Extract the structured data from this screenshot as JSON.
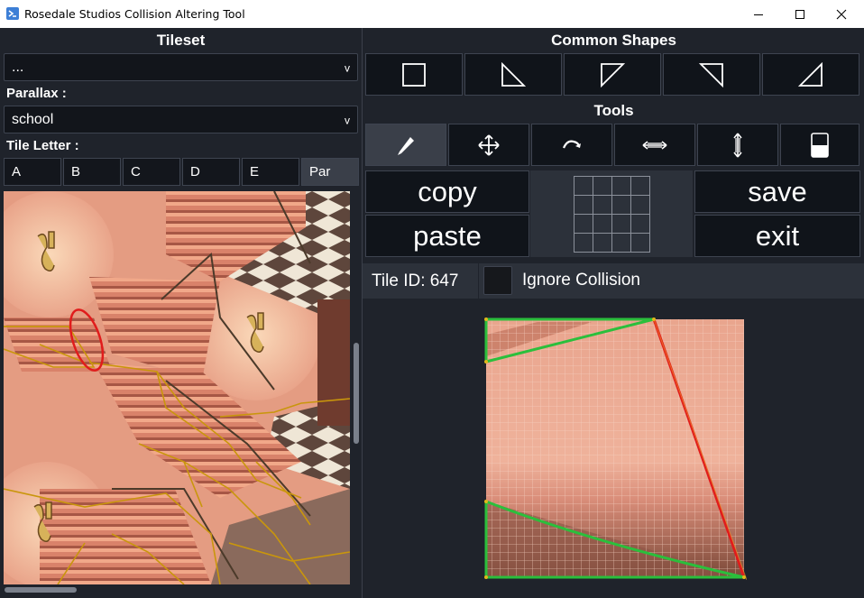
{
  "window": {
    "title": "Rosedale Studios Collision Altering Tool",
    "controls": [
      "minimize-icon",
      "maximize-icon",
      "close-icon"
    ]
  },
  "left_panel": {
    "tileset_header": "Tileset",
    "tileset_value": "...",
    "parallax_label": "Parallax :",
    "parallax_value": "school",
    "tile_letter_label": "Tile Letter :",
    "letters": [
      "A",
      "B",
      "C",
      "D",
      "E",
      "Par"
    ],
    "active_letter": "Par",
    "dropdown_arrow": "v"
  },
  "right_panel": {
    "common_shapes_header": "Common Shapes",
    "shapes": [
      "square-shape-icon",
      "triangle-bottom-left-icon",
      "triangle-top-left-icon",
      "triangle-top-right-icon",
      "triangle-bottom-right-icon"
    ],
    "tools_header": "Tools",
    "tools": [
      "pencil-icon",
      "move-icon",
      "rotate-icon",
      "flip-horizontal-icon",
      "flip-vertical-icon",
      "fill-icon"
    ],
    "active_tool": "pencil-icon",
    "copy_label": "copy",
    "paste_label": "paste",
    "save_label": "save",
    "exit_label": "exit",
    "tile_id_label": "Tile ID: 647",
    "ignore_collision_label": "Ignore Collision",
    "ignore_collision_checked": false
  },
  "colors": {
    "background": "#1f232b",
    "button": "#10141a",
    "panel": "#2c313a",
    "collision_outline": "#c9960c",
    "collision_edge_green": "#2bbf3c",
    "collision_edge_red": "#e01c1c"
  }
}
